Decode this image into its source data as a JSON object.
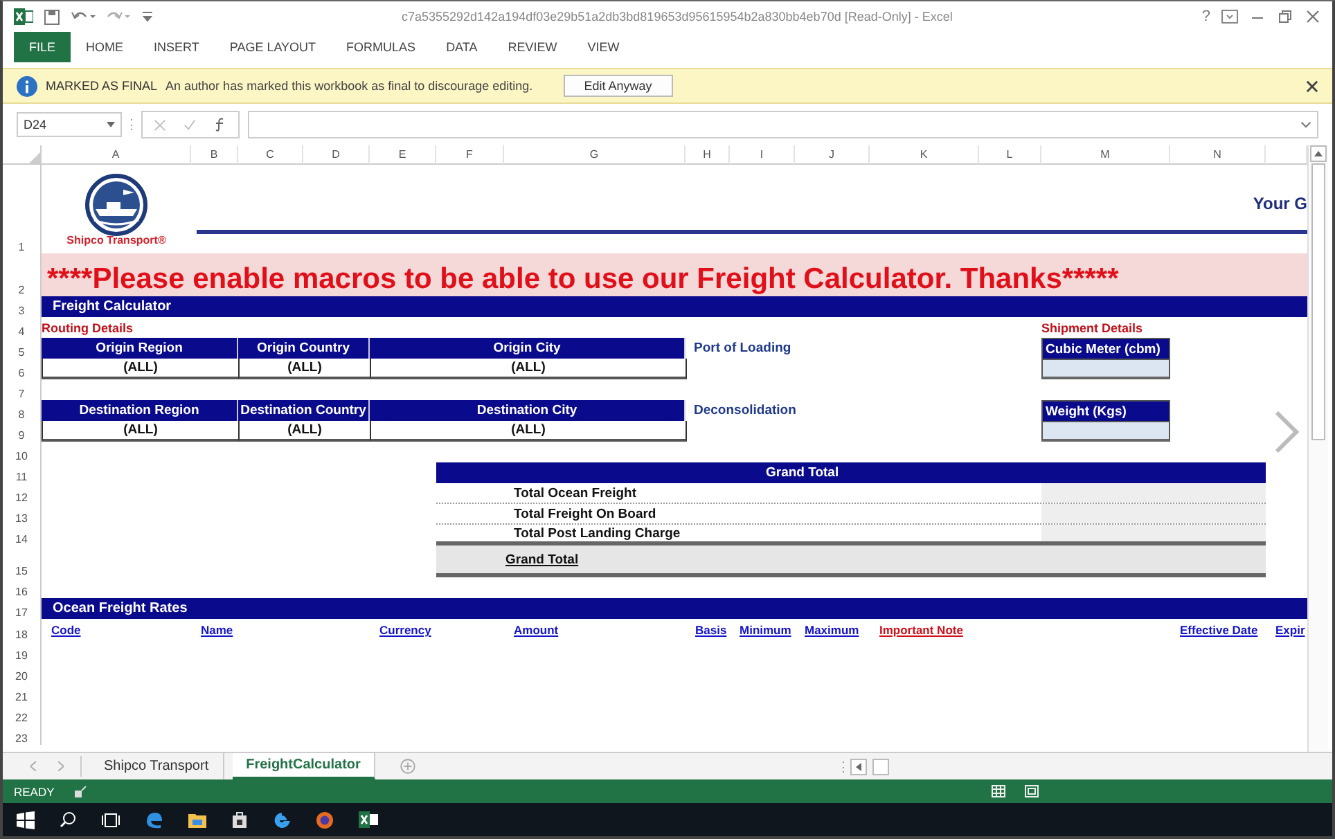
{
  "window": {
    "title": "c7a5355292d142a194df03e29b51a2db3bd819653d95615954b2a830bb4eb70d  [Read-Only] - Excel",
    "help": "?"
  },
  "ribbon_tabs": [
    {
      "label": "FILE",
      "kind": "file"
    },
    {
      "label": "HOME",
      "kind": "tab"
    },
    {
      "label": "INSERT",
      "kind": "tab"
    },
    {
      "label": "PAGE LAYOUT",
      "kind": "tab"
    },
    {
      "label": "FORMULAS",
      "kind": "tab"
    },
    {
      "label": "DATA",
      "kind": "tab"
    },
    {
      "label": "REVIEW",
      "kind": "tab"
    },
    {
      "label": "VIEW",
      "kind": "tab"
    }
  ],
  "message_bar": {
    "title": "MARKED AS FINAL",
    "text": "An author has marked this workbook as final to discourage editing.",
    "button": "Edit Anyway"
  },
  "formula_bar": {
    "name_box": "D24"
  },
  "columns": [
    "A",
    "B",
    "C",
    "D",
    "E",
    "F",
    "G",
    "H",
    "I",
    "J",
    "K",
    "L",
    "M",
    "N"
  ],
  "rows": [
    "1",
    "2",
    "3",
    "4",
    "5",
    "6",
    "7",
    "8",
    "9",
    "10",
    "11",
    "12",
    "13",
    "14",
    "15",
    "16",
    "17",
    "18",
    "19",
    "20",
    "21",
    "22",
    "23"
  ],
  "sheet": {
    "logo_text": "Shipco Transport®",
    "tagline": "Your G",
    "banner": "****Please enable macros to be able to use our Freight Calculator. Thanks*****",
    "section_title": "Freight Calculator",
    "routing_label": "Routing Details",
    "shipment_label": "Shipment Details",
    "routing_groups": [
      {
        "fields": [
          {
            "label": "Origin Region",
            "value": "(ALL)"
          },
          {
            "label": "Origin Country",
            "value": "(ALL)"
          },
          {
            "label": "Origin City",
            "value": "(ALL)"
          }
        ],
        "side_label": "Port of Loading"
      },
      {
        "fields": [
          {
            "label": "Destination Region",
            "value": "(ALL)"
          },
          {
            "label": "Destination Country",
            "value": "(ALL)"
          },
          {
            "label": "Destination City",
            "value": "(ALL)"
          }
        ],
        "side_label": "Deconsolidation"
      }
    ],
    "shipment_inputs": [
      {
        "label": "Cubic Meter (cbm)"
      },
      {
        "label": "Weight (Kgs)"
      }
    ],
    "grand_total": {
      "header": "Grand Total",
      "lines": [
        "Total Ocean Freight",
        "Total Freight On Board",
        "Total Post Landing Charge"
      ],
      "total": "Grand Total"
    },
    "rates": {
      "title": "Ocean Freight Rates",
      "columns": [
        {
          "label": "Code",
          "kind": "link"
        },
        {
          "label": "Name",
          "kind": "link"
        },
        {
          "label": "Currency",
          "kind": "link"
        },
        {
          "label": "Amount",
          "kind": "link"
        },
        {
          "label": "Basis",
          "kind": "link"
        },
        {
          "label": "Minimum",
          "kind": "link"
        },
        {
          "label": "Maximum",
          "kind": "link"
        },
        {
          "label": "Important Note",
          "kind": "note"
        },
        {
          "label": "Effective Date",
          "kind": "link"
        },
        {
          "label": "Expir",
          "kind": "link"
        }
      ]
    }
  },
  "sheet_tabs": [
    {
      "label": "Shipco Transport",
      "selected": false
    },
    {
      "label": "FreightCalculator",
      "selected": true
    }
  ],
  "status_bar": {
    "mode": "READY"
  }
}
